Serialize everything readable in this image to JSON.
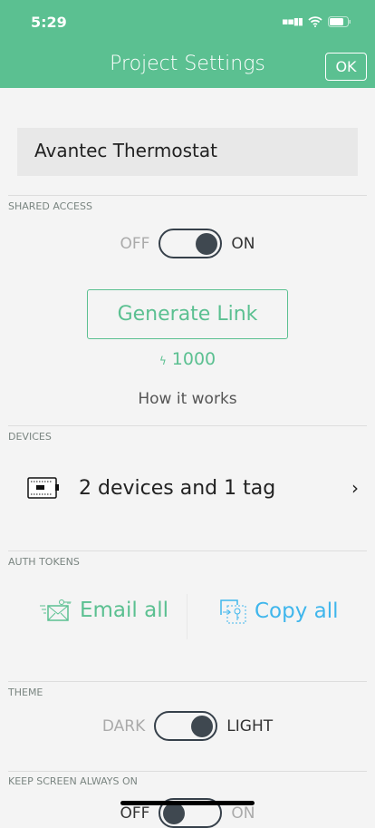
{
  "status_bar": {
    "time": "5:29"
  },
  "header": {
    "title": "Project Settings",
    "ok_label": "OK"
  },
  "project_name": "Avantec Thermostat",
  "shared_access": {
    "label": "SHARED ACCESS",
    "off": "OFF",
    "on": "ON",
    "enabled": true,
    "generate_label": "Generate Link",
    "energy": "1000",
    "energy_icon": "bolt",
    "how_it_works": "How it works"
  },
  "devices": {
    "label": "DEVICES",
    "summary": "2 devices and 1 tag"
  },
  "auth_tokens": {
    "label": "AUTH TOKENS",
    "email_all": "Email all",
    "copy_all": "Copy all"
  },
  "theme": {
    "label": "THEME",
    "dark": "DARK",
    "light": "LIGHT",
    "value": "light"
  },
  "keep_screen": {
    "label": "KEEP SCREEN ALWAYS ON",
    "off": "OFF",
    "on": "ON",
    "enabled": false
  },
  "colors": {
    "accent": "#5bc091",
    "blue": "#3fb6ec"
  }
}
